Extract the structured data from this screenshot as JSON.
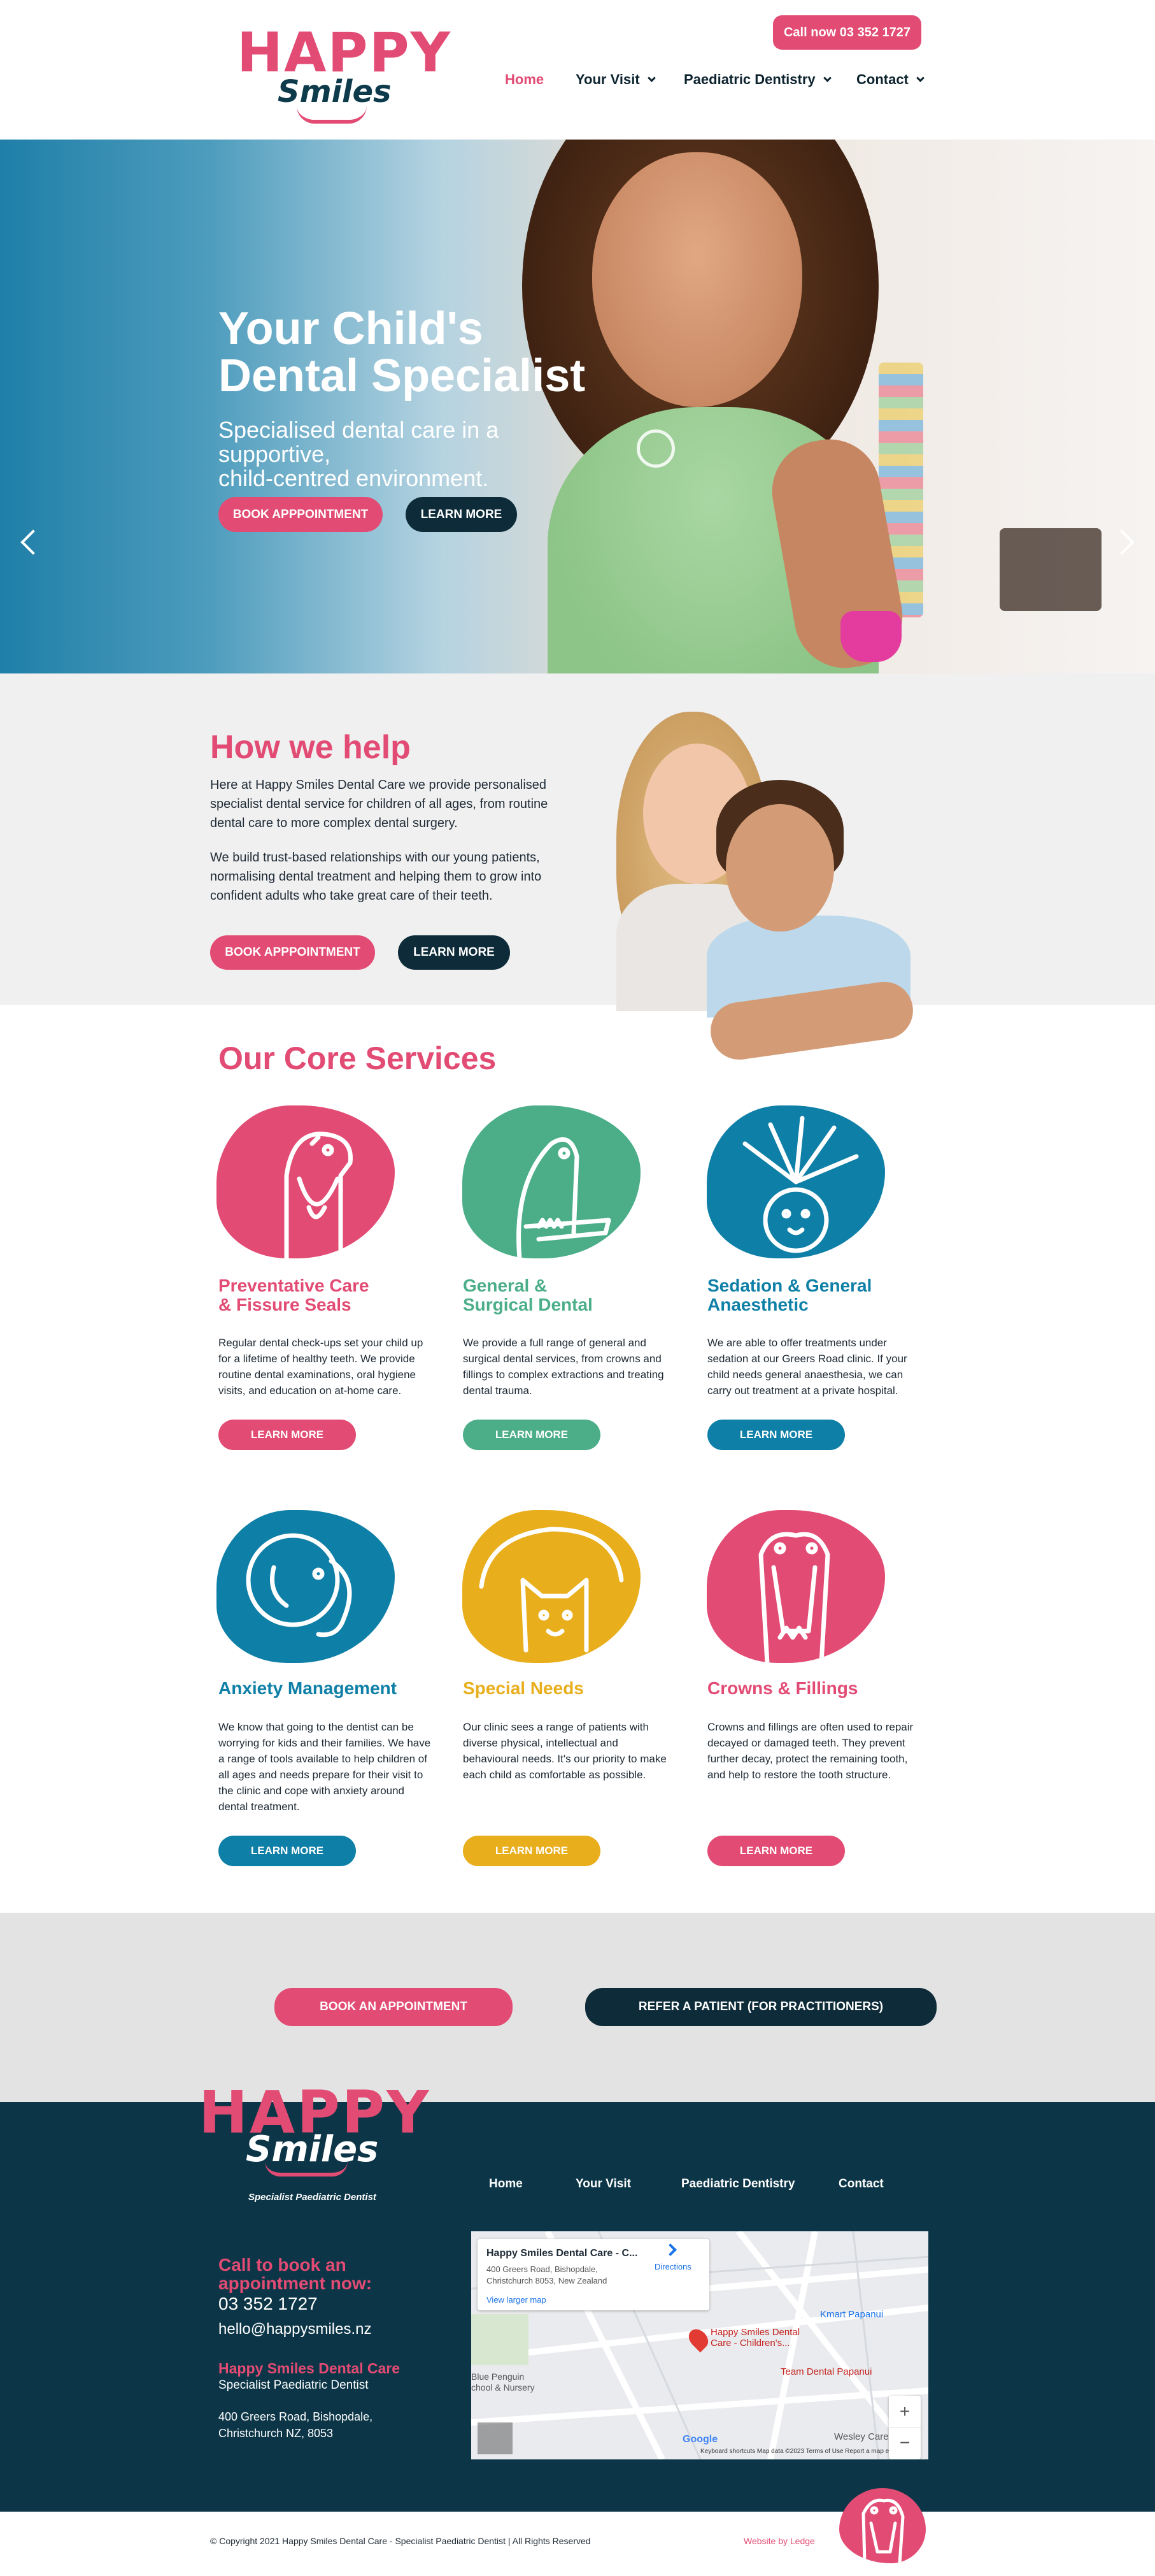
{
  "header": {
    "logo_happy": "HAPPY",
    "logo_smiles": "Smiles",
    "call_button": "Call now 03 352 1727",
    "nav": [
      {
        "label": "Home",
        "has_dropdown": false,
        "active": true
      },
      {
        "label": "Your Visit",
        "has_dropdown": true
      },
      {
        "label": "Paediatric Dentistry",
        "has_dropdown": true
      },
      {
        "label": "Contact",
        "has_dropdown": true
      }
    ]
  },
  "hero": {
    "title_line1": "Your Child's",
    "title_line2": "Dental Specialist",
    "subtitle_line1": "Specialised dental care in a supportive,",
    "subtitle_line2": "child-centred environment.",
    "btn_book": "BOOK APPPOINTMENT",
    "btn_learn": "LEARN MORE",
    "slides": 3,
    "active_slide": 1,
    "prev_icon": "chevron-left-icon",
    "next_icon": "chevron-right-icon"
  },
  "help": {
    "title": "How we help",
    "para1_l1": "Here at Happy Smiles Dental Care we provide personalised",
    "para1_l2": "specialist dental service for children of all ages, from routine",
    "para1_l3": "dental care to more complex dental surgery.",
    "para2_l1": "We build trust-based relationships with our young patients,",
    "para2_l2": "normalising dental treatment and helping them to grow into",
    "para2_l3": "confident adults who take great care of their teeth.",
    "btn_book": "BOOK APPPOINTMENT",
    "btn_learn": "LEARN MORE"
  },
  "services": {
    "title": "Our Core Services",
    "items": [
      {
        "title_l1": "Preventative Care",
        "title_l2": "& Fissure Seals",
        "color": "#e24b73",
        "animal": "hippo-icon",
        "desc": [
          "Regular dental check-ups set your child up",
          "for a lifetime of healthy teeth. We provide",
          "routine dental examinations, oral hygiene",
          "visits, and education on at-home care."
        ],
        "button": "LEARN MORE"
      },
      {
        "title_l1": "General &",
        "title_l2": "Surgical Dental",
        "color": "#4bae89",
        "animal": "crocodile-icon",
        "desc": [
          "We provide a full range of general and",
          "surgical dental services, from crowns and",
          "fillings to complex extractions and treating",
          "dental trauma."
        ],
        "button": "LEARN MORE"
      },
      {
        "title_l1": "Sedation & General",
        "title_l2": "Anaesthetic",
        "color": "#0e7fa6",
        "animal": "lion-icon",
        "desc": [
          "We are able to offer treatments under",
          "sedation at our Greers Road clinic. If your",
          "child needs general anaesthesia, we can",
          "carry out treatment at a private hospital."
        ],
        "button": "LEARN MORE"
      },
      {
        "title_l1": "Anxiety Management",
        "title_l2": "",
        "color": "#0e7fa6",
        "animal": "elephant-icon",
        "desc": [
          "We know that going to the dentist can be",
          "worrying for kids and their families. We have",
          "a range of tools available to help children of",
          "all ages and needs prepare for their visit to",
          "the clinic and cope with anxiety around",
          "dental treatment."
        ],
        "button": "LEARN MORE"
      },
      {
        "title_l1": "Special Needs",
        "title_l2": "",
        "color": "#e8ae1c",
        "animal": "cat-icon",
        "desc": [
          "Our clinic sees a range of patients with",
          "diverse physical, intellectual and",
          "behavioural needs. It's our priority to make",
          "each child as comfortable as possible."
        ],
        "button": "LEARN MORE"
      },
      {
        "title_l1": "Crowns & Fillings",
        "title_l2": "",
        "color": "#e24b73",
        "animal": "hippo-icon",
        "desc": [
          "Crowns and fillings are often used to repair",
          "decayed or damaged teeth. They prevent",
          "further decay, protect the remaining tooth,",
          "and help to restore the tooth structure."
        ],
        "button": "LEARN MORE"
      }
    ]
  },
  "cta": {
    "book": "BOOK AN APPOINTMENT",
    "refer": "REFER A PATIENT (FOR PRACTITIONERS)"
  },
  "footer": {
    "logo_happy": "HAPPY",
    "logo_smiles": "Smiles",
    "tagline": "Specialist Paediatric Dentist",
    "nav": [
      "Home",
      "Your Visit",
      "Paediatric Dentistry",
      "Contact"
    ],
    "call_l1": "Call to book an",
    "call_l2": "appointment now:",
    "phone": "03 352 1727",
    "email": "hello@happysmiles.nz",
    "clinic_name": "Happy Smiles Dental Care",
    "clinic_sub": "Specialist Paediatric Dentist",
    "address_l1": "400 Greers Road, Bishopdale,",
    "address_l2": "Christchurch NZ, 8053",
    "map": {
      "card_title": "Happy Smiles Dental Care - C...",
      "card_addr1": "400 Greers Road, Bishopdale,",
      "card_addr2": "Christchurch 8053, New Zealand",
      "directions": "Directions",
      "larger_map": "View larger map",
      "pin_label1": "Happy Smiles Dental",
      "pin_label2": "Care - Children's...",
      "team_dental": "Team Dental Papanui",
      "kmart": "Kmart Papanui",
      "wesley": "Wesley Care",
      "blue_penguin1": "Blue Penguin",
      "blue_penguin2": "chool & Nursery",
      "google": "Google",
      "attribution": "Keyboard shortcuts   Map data ©2023   Terms of Use   Report a map error",
      "zoom_in": "+",
      "zoom_out": "−"
    }
  },
  "copyright": {
    "text": "© Copyright 2021 Happy Smiles Dental Care - Specialist Paediatric Dentist | All Rights Reserved",
    "credit": "Website by Ledge"
  },
  "colors": {
    "pink": "#e24b73",
    "navy": "#0c3647",
    "teal": "#0e7fa6",
    "green": "#4bae89",
    "yellow": "#e8ae1c"
  }
}
